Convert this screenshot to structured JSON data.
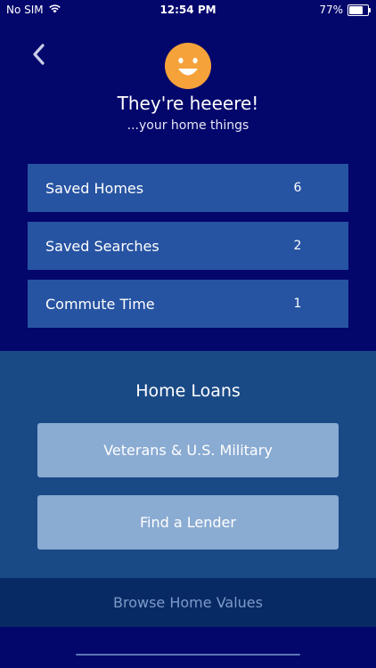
{
  "status_bar": {
    "carrier": "No SIM",
    "time": "12:54 PM",
    "battery_percent_label": "77%",
    "battery_level": 0.77
  },
  "header": {
    "title": "They're heeere!",
    "subtitle": "...your home things"
  },
  "items": [
    {
      "label": "Saved Homes",
      "count": "6"
    },
    {
      "label": "Saved Searches",
      "count": "2"
    },
    {
      "label": "Commute Time",
      "count": "1"
    }
  ],
  "home_loans": {
    "title": "Home Loans",
    "buttons": [
      {
        "label": "Veterans & U.S. Military"
      },
      {
        "label": "Find a Lender"
      }
    ]
  },
  "browse": {
    "label": "Browse Home Values"
  },
  "colors": {
    "background": "#03066b",
    "row": "#2754a2",
    "loans_section": "#1a4a86",
    "loan_button": "#8aabd2",
    "browse_bar": "#072a64",
    "smiley": "#f5a23a"
  }
}
